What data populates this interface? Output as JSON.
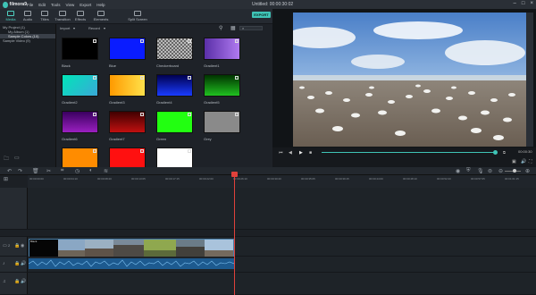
{
  "app": {
    "name": "filmora9",
    "window_title": "Untitled: 00:00:30:02"
  },
  "menu": [
    "File",
    "Edit",
    "Tools",
    "View",
    "Export",
    "Help"
  ],
  "toolbar": {
    "items": [
      {
        "label": "Media",
        "icon": "media-icon",
        "active": true
      },
      {
        "label": "Audio",
        "icon": "audio-icon"
      },
      {
        "label": "Titles",
        "icon": "titles-icon"
      },
      {
        "label": "Transition",
        "icon": "transition-icon"
      },
      {
        "label": "Effects",
        "icon": "effects-icon"
      },
      {
        "label": "Elements",
        "icon": "elements-icon"
      },
      {
        "label": "Split Screen",
        "icon": "split-screen-icon"
      }
    ],
    "export_label": "EXPORT"
  },
  "sidebar": {
    "items": [
      {
        "label": "My Project (1)"
      },
      {
        "label": "My Album (1)",
        "indent": true
      },
      {
        "label": "Sample Colors (10)",
        "indent": true,
        "selected": true
      },
      {
        "label": "Sample Video (9)"
      }
    ]
  },
  "library": {
    "import_label": "Import",
    "record_label": "Record",
    "thumbs": [
      {
        "label": "Black",
        "color": "#000000"
      },
      {
        "label": "Blue",
        "color": "#0a1cff"
      },
      {
        "label": "Checkerboard",
        "color": "checker"
      },
      {
        "label": "Gradient1",
        "color": "linear-gradient(90deg,#5a2fa8,#b07af0)"
      },
      {
        "label": "Gradient2",
        "color": "linear-gradient(135deg,#00e6b8,#3aa8d8)"
      },
      {
        "label": "Gradient3",
        "color": "linear-gradient(90deg,#ff9a00,#ffe14a)"
      },
      {
        "label": "Gradient4",
        "color": "linear-gradient(180deg,#000050,#1a3cff)"
      },
      {
        "label": "Gradient5",
        "color": "linear-gradient(180deg,#003300,#20c020)"
      },
      {
        "label": "Gradient6",
        "color": "linear-gradient(180deg,#3a0060,#9a20c0)"
      },
      {
        "label": "Gradient7",
        "color": "linear-gradient(180deg,#400000,#c01010)"
      },
      {
        "label": "Green",
        "color": "#22ff11"
      },
      {
        "label": "Grey",
        "color": "#8a8a8a"
      },
      {
        "label": "",
        "color": "#ff8c00"
      },
      {
        "label": "",
        "color": "#ff1010"
      },
      {
        "label": "",
        "color": "#ffffff"
      }
    ]
  },
  "preview": {
    "timecode": "00:00:30"
  },
  "timeline": {
    "ruler": [
      "00:00:00:00",
      "00:00:04:10",
      "00:00:08:20",
      "00:00:13:05",
      "00:00:17:15",
      "00:00:22:00",
      "00:00:26:10",
      "00:00:30:20",
      "00:00:35:05",
      "00:00:39:15",
      "00:00:44:00",
      "00:00:48:10",
      "00:00:52:20",
      "00:00:57:05",
      "00:01:01:15"
    ],
    "video_track_label": "2",
    "clip_label": "Black"
  }
}
